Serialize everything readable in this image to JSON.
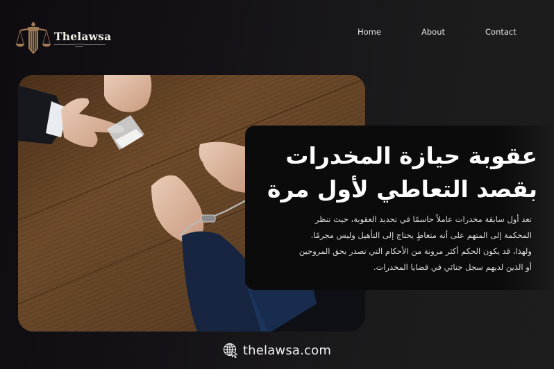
{
  "header": {
    "logo": {
      "name": "Thelawsa",
      "icon": "scales-of-justice-pillar-icon",
      "color": "#a07a55"
    },
    "nav": [
      {
        "label": "Home"
      },
      {
        "label": "About"
      },
      {
        "label": "Contact"
      }
    ]
  },
  "hero": {
    "image": {
      "description": "Handcuffed person's hands on a wooden table across from a suited lawyer holding a small plastic bag",
      "icon": "photo"
    },
    "title_lines": [
      "عقوبة حيازة المخدرات",
      "بقصد التعاطي لأول مرة"
    ],
    "body_lines": [
      "تعد أول سابقة مخدرات عاملاً حاسمًا في تحديد العقوبة، حيث تنظر",
      "المحكمة إلى المتهم على أنه متعاطٍ يحتاج إلى التأهيل وليس مجرمًا.",
      "ولهذا، قد يكون الحكم أكثر مرونة من الأحكام التي تصدر بحق المروجين",
      "أو الذين لديهم سجل جنائي في قضايا المخدرات."
    ]
  },
  "footer": {
    "icon": "globe-cursor-icon",
    "url": "thelawsa.com"
  },
  "colors": {
    "background": "#141216",
    "card": "#0b0b0c",
    "accent_gold": "#a07a55",
    "text": "#ffffff"
  }
}
